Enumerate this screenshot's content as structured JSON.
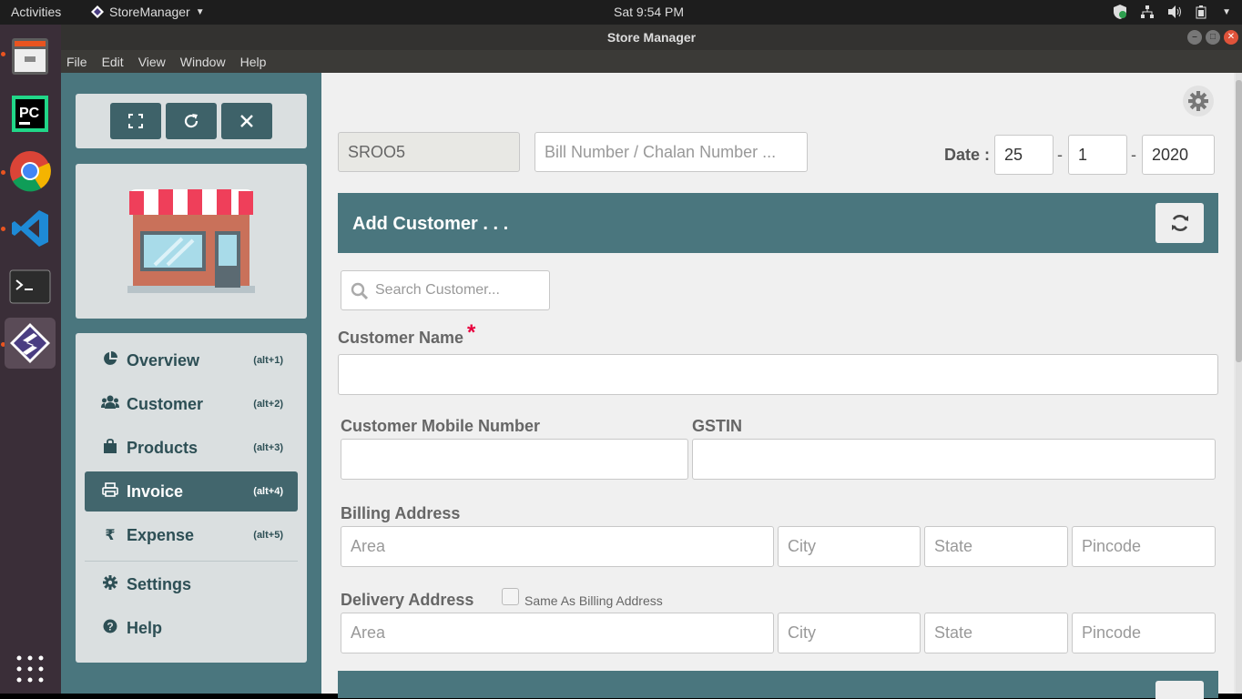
{
  "topbar": {
    "activities": "Activities",
    "app_name": "StoreManager",
    "clock": "Sat  9:54 PM"
  },
  "window": {
    "title": "Store Manager"
  },
  "menu": {
    "items": [
      "File",
      "Edit",
      "View",
      "Window",
      "Help"
    ]
  },
  "sidebar": {
    "nav": [
      {
        "label": "Overview",
        "shortcut": "(alt+1)",
        "icon": "pie-chart-icon"
      },
      {
        "label": "Customer",
        "shortcut": "(alt+2)",
        "icon": "users-icon"
      },
      {
        "label": "Products",
        "shortcut": "(alt+3)",
        "icon": "shopping-bag-icon"
      },
      {
        "label": "Invoice",
        "shortcut": "(alt+4)",
        "icon": "printer-icon",
        "selected": true
      },
      {
        "label": "Expense",
        "shortcut": "(alt+5)",
        "icon": "rupee-icon"
      }
    ],
    "settings_label": "Settings",
    "help_label": "Help"
  },
  "invoice": {
    "store_code": "SROO5",
    "bill_placeholder": "Bill Number / Chalan Number ...",
    "date_label": "Date :",
    "date_day": "25",
    "date_month": "1",
    "date_year": "2020",
    "date_sep": "-"
  },
  "customer_section": {
    "title": "Add Customer . . .",
    "search_placeholder": "Search Customer...",
    "name_label": "Customer Name",
    "required_mark": "*",
    "mobile_label": "Customer Mobile Number",
    "gstin_label": "GSTIN",
    "billing_label": "Billing Address",
    "delivery_label": "Delivery Address",
    "same_as_billing": "Same As Billing Address",
    "area_placeholder": "Area",
    "city_placeholder": "City",
    "state_placeholder": "State",
    "pincode_placeholder": "Pincode"
  },
  "colors": {
    "accent": "#4a767e",
    "accent_dark": "#3e6269",
    "required": "#e8003d"
  }
}
